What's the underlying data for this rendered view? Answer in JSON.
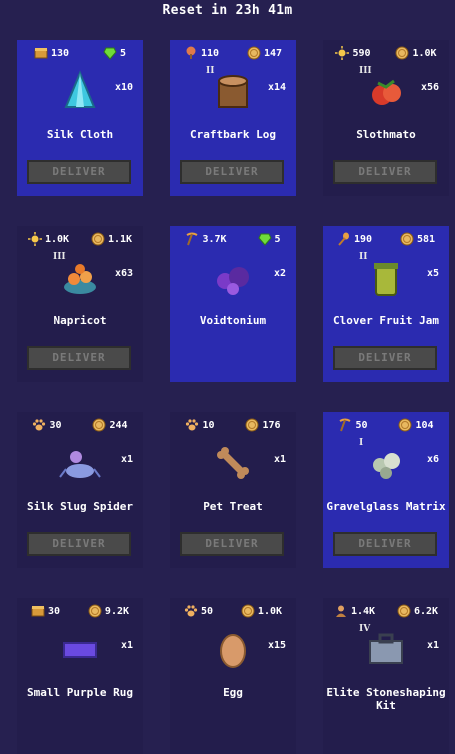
{
  "header": {
    "reset_text": "Reset in 23h 41m"
  },
  "deliver_label": "DELIVER",
  "colors": {
    "card_highlight": "#2b2bb0",
    "card_plain": "#231d4c",
    "background": "#262050",
    "deliver_disabled": "#4a4a4a"
  },
  "orders": [
    {
      "name": "Silk Cloth",
      "tier": "",
      "qty": "x10",
      "highlight": true,
      "icon": "silk-cloth-icon",
      "rewards": [
        {
          "icon": "chest-icon",
          "value": "130"
        },
        {
          "icon": "gem-icon",
          "value": "5"
        }
      ],
      "deliver": true
    },
    {
      "name": "Craftbark Log",
      "tier": "II",
      "qty": "x14",
      "highlight": true,
      "icon": "log-icon",
      "rewards": [
        {
          "icon": "tree-icon",
          "value": "110"
        },
        {
          "icon": "coin-icon",
          "value": "147"
        }
      ],
      "deliver": true
    },
    {
      "name": "Slothmato",
      "tier": "III",
      "qty": "x56",
      "highlight": false,
      "icon": "tomato-icon",
      "rewards": [
        {
          "icon": "sun-icon",
          "value": "590"
        },
        {
          "icon": "coin-icon",
          "value": "1.0K"
        }
      ],
      "deliver": true
    },
    {
      "name": "Napricot",
      "tier": "III",
      "qty": "x63",
      "highlight": false,
      "icon": "napricot-icon",
      "rewards": [
        {
          "icon": "sun-icon",
          "value": "1.0K"
        },
        {
          "icon": "coin-icon",
          "value": "1.1K"
        }
      ],
      "deliver": true
    },
    {
      "name": "Voidtonium",
      "tier": "",
      "qty": "x2",
      "highlight": true,
      "icon": "ore-icon",
      "rewards": [
        {
          "icon": "pickaxe-icon",
          "value": "3.7K"
        },
        {
          "icon": "gem-icon",
          "value": "5"
        }
      ],
      "deliver": false
    },
    {
      "name": "Clover Fruit Jam",
      "tier": "II",
      "qty": "x5",
      "highlight": true,
      "icon": "jam-jar-icon",
      "rewards": [
        {
          "icon": "spoon-icon",
          "value": "190"
        },
        {
          "icon": "coin-icon",
          "value": "581"
        }
      ],
      "deliver": true
    },
    {
      "name": "Silk Slug Spider",
      "tier": "",
      "qty": "x1",
      "highlight": false,
      "icon": "spider-icon",
      "rewards": [
        {
          "icon": "paw-icon",
          "value": "30"
        },
        {
          "icon": "coin-icon",
          "value": "244"
        }
      ],
      "deliver": true
    },
    {
      "name": "Pet Treat",
      "tier": "",
      "qty": "x1",
      "highlight": false,
      "icon": "bone-icon",
      "rewards": [
        {
          "icon": "paw-icon",
          "value": "10"
        },
        {
          "icon": "coin-icon",
          "value": "176"
        }
      ],
      "deliver": true
    },
    {
      "name": "Gravelglass Matrix",
      "tier": "I",
      "qty": "x6",
      "highlight": true,
      "icon": "gravel-icon",
      "rewards": [
        {
          "icon": "pickaxe-icon",
          "value": "50"
        },
        {
          "icon": "coin-icon",
          "value": "104"
        }
      ],
      "deliver": true
    },
    {
      "name": "Small Purple Rug",
      "tier": "",
      "qty": "x1",
      "highlight": false,
      "icon": "rug-icon",
      "rewards": [
        {
          "icon": "chest-icon",
          "value": "30"
        },
        {
          "icon": "coin-icon",
          "value": "9.2K"
        }
      ],
      "deliver": false
    },
    {
      "name": "Egg",
      "tier": "",
      "qty": "x15",
      "highlight": false,
      "icon": "egg-icon",
      "rewards": [
        {
          "icon": "paw-icon",
          "value": "50"
        },
        {
          "icon": "coin-icon",
          "value": "1.0K"
        }
      ],
      "deliver": false
    },
    {
      "name": "Elite Stoneshaping Kit",
      "tier": "IV",
      "qty": "x1",
      "highlight": false,
      "icon": "toolbox-icon",
      "rewards": [
        {
          "icon": "bust-icon",
          "value": "1.4K"
        },
        {
          "icon": "coin-icon",
          "value": "6.2K"
        }
      ],
      "deliver": false
    }
  ]
}
